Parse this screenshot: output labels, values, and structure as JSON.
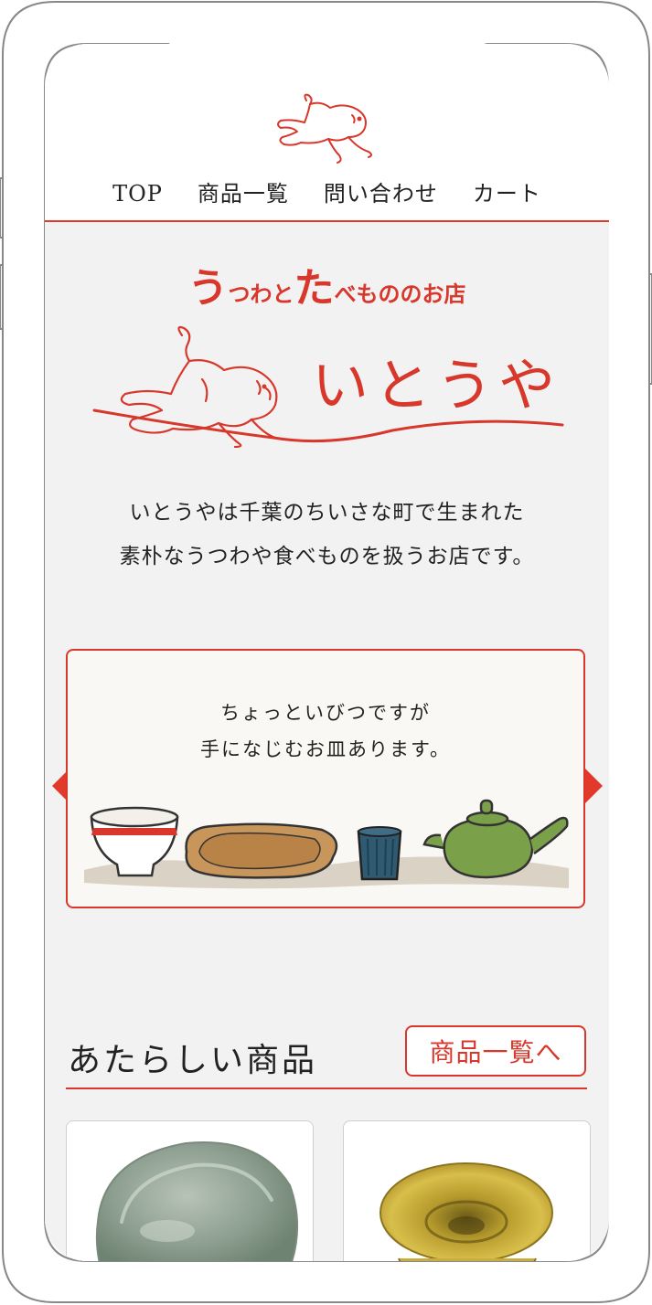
{
  "nav": {
    "items": [
      {
        "label": "TOP"
      },
      {
        "label": "商品一覧"
      },
      {
        "label": "問い合わせ"
      },
      {
        "label": "カート"
      }
    ]
  },
  "hero": {
    "catch": [
      {
        "text": "う",
        "size": "big"
      },
      {
        "text": "つわと",
        "size": "small"
      },
      {
        "text": "た",
        "size": "big"
      },
      {
        "text": "べもののお店",
        "size": "small"
      }
    ],
    "shop_name": "いとうや",
    "intro_line1": "いとうやは千葉のちいさな町で生まれた",
    "intro_line2": "素朴なうつわや食べものを扱うお店です。"
  },
  "banner": {
    "line1": "ちょっといびつですが",
    "line2": "手になじむお皿あります。"
  },
  "new_products": {
    "title": "あたらしい商品",
    "button_label": "商品一覧へ"
  },
  "colors": {
    "accent": "#d8372b",
    "background": "#f2f2f2",
    "frame": "#e1392b"
  },
  "icons": {
    "logo": "running-dog-icon",
    "prev": "arrow-left-icon",
    "next": "arrow-right-icon"
  }
}
